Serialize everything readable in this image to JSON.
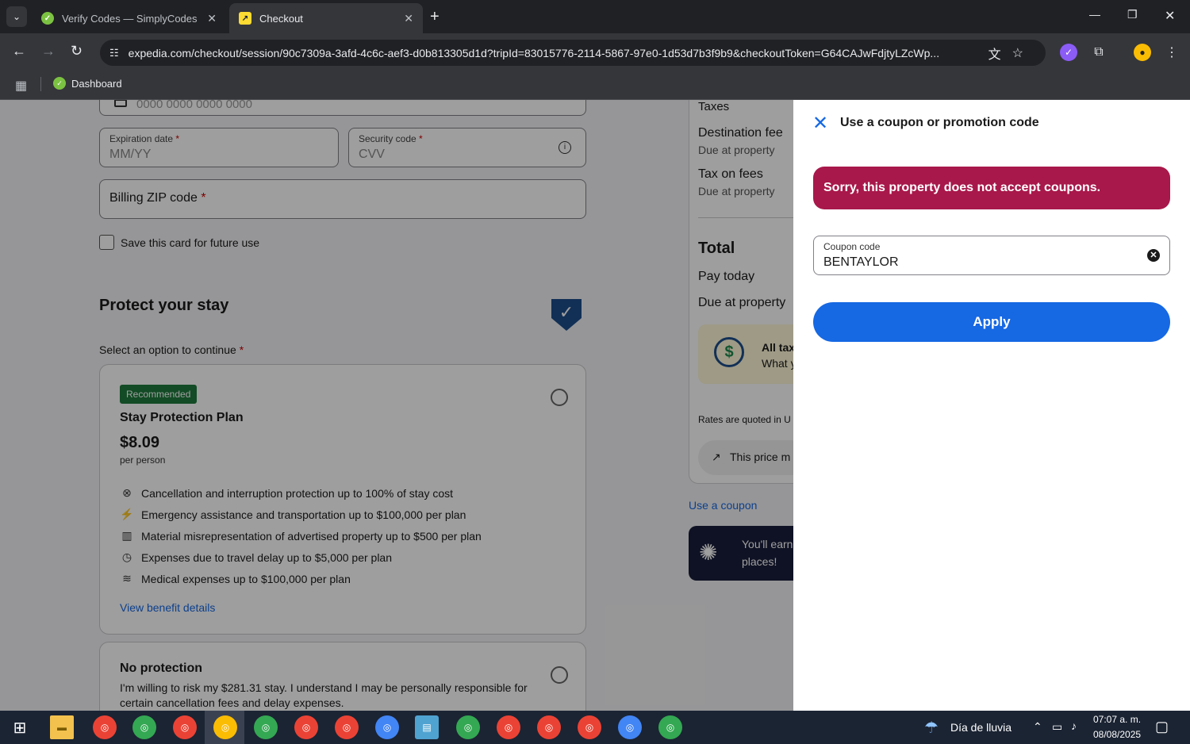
{
  "browser": {
    "tabs": [
      {
        "title": "Verify Codes — SimplyCodes",
        "favicon": "simplycodes-icon",
        "color": "#7cc242"
      },
      {
        "title": "Checkout",
        "favicon": "expedia-icon",
        "color": "#fddb32"
      }
    ],
    "url": "expedia.com/checkout/session/90c7309a-3afd-4c6c-aef3-d0b813305d1d?tripId=83015776-2114-5867-97e0-1d53d7b3f9b9&checkoutToken=G64CAJwFdjtyLZcWp...",
    "bookmarks": [
      {
        "label": "Dashboard"
      }
    ]
  },
  "checkout": {
    "card_number_placeholder": "0000 0000 0000 0000",
    "expiration": {
      "label": "Expiration date",
      "required": "*",
      "placeholder": "MM/YY"
    },
    "security": {
      "label": "Security code",
      "required": "*",
      "placeholder": "CVV"
    },
    "zip": {
      "label": "Billing ZIP code",
      "required": "*"
    },
    "save_card": "Save this card for future use",
    "protect_heading": "Protect your stay",
    "select_option": "Select an option to continue",
    "select_required": "*",
    "plan": {
      "badge": "Recommended",
      "title": "Stay Protection Plan",
      "price": "$8.09",
      "per": "per person",
      "benefits": [
        {
          "icon": "cancel-icon",
          "text": "Cancellation and interruption protection up to 100% of stay cost"
        },
        {
          "icon": "running-person-icon",
          "text": "Emergency assistance and transportation up to $100,000 per plan"
        },
        {
          "icon": "building-icon",
          "text": "Material misrepresentation of advertised property up to $500 per plan"
        },
        {
          "icon": "clock-icon",
          "text": "Expenses due to travel delay up to $5,000 per plan"
        },
        {
          "icon": "medical-icon",
          "text": "Medical expenses up to $100,000 per plan"
        }
      ],
      "view_details": "View benefit details"
    },
    "no_protection": {
      "title": "No protection",
      "text": "I'm willing to risk my $281.31 stay. I understand I may be personally responsible for certain cancellation fees and delay expenses."
    }
  },
  "summary": {
    "taxes": "Taxes",
    "destination_fee": "Destination fee",
    "due_at_property_1": "Due at property",
    "tax_on_fees": "Tax on fees",
    "due_at_property_2": "Due at property",
    "total": "Total",
    "pay_today": "Pay today",
    "due_at_property_3": "Due at property",
    "tax_box_line1": "All tax",
    "tax_box_line2": "What y",
    "rates_quoted": "Rates are quoted in U",
    "price_match": "This price m",
    "use_coupon": "Use a coupon",
    "rewards_line1": "You'll earn",
    "rewards_line2": "places!"
  },
  "coupon_panel": {
    "title": "Use a coupon or promotion code",
    "error": "Sorry, this property does not accept coupons.",
    "field_label": "Coupon code",
    "field_value": "BENTAYLOR",
    "apply": "Apply",
    "error_color": "#a8184a",
    "accent_color": "#1668e3"
  },
  "taskbar": {
    "weather": "Día de lluvia",
    "time": "07:07 a. m.",
    "date": "08/08/2025"
  }
}
